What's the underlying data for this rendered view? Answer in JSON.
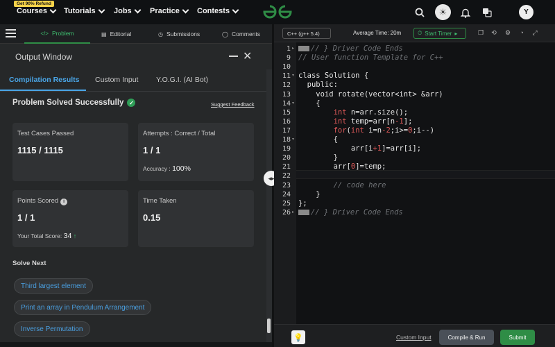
{
  "topnav": {
    "refund_badge": "Get 90% Refund",
    "items": [
      "Courses",
      "Tutorials",
      "Jobs",
      "Practice",
      "Contests"
    ],
    "logo": "gfg-logo",
    "avatar_letter": "Y"
  },
  "problem_tabs": {
    "items": [
      "Problem",
      "Editorial",
      "Submissions",
      "Comments"
    ],
    "active": "Problem"
  },
  "output": {
    "title": "Output Window",
    "tabs": [
      "Compilation Results",
      "Custom Input",
      "Y.O.G.I. (AI Bot)"
    ],
    "active_tab": "Compilation Results",
    "status": "Problem Solved Successfully",
    "feedback_link": "Suggest Feedback",
    "cards": {
      "test_cases_label": "Test Cases Passed",
      "test_cases_value": "1115 / 1115",
      "attempts_label": "Attempts : Correct / Total",
      "attempts_value": "1 / 1",
      "accuracy_label": "Accuracy :",
      "accuracy_value": "100%",
      "points_label": "Points Scored",
      "points_value": "1 / 1",
      "total_score_label": "Your Total Score:",
      "total_score_value": "34",
      "time_label": "Time Taken",
      "time_value": "0.15"
    },
    "solve_next_label": "Solve Next",
    "solve_next": [
      "Third largest element",
      "Print an array in Pendulum Arrangement",
      "Inverse Permutation"
    ]
  },
  "editor": {
    "language": "C++ (g++ 5.4)",
    "avg_time": "Average Time: 20m",
    "timer_label": "Start Timer",
    "lines": [
      {
        "n": "1",
        "fold": "▸",
        "parts": [
          [
            "marker",
            ""
          ],
          [
            "cmt",
            "// } Driver Code Ends"
          ]
        ]
      },
      {
        "n": "9",
        "fold": "",
        "parts": [
          [
            "cmt",
            "// User function Template for C++"
          ]
        ]
      },
      {
        "n": "10",
        "fold": "",
        "parts": []
      },
      {
        "n": "11",
        "fold": "▾",
        "parts": [
          [
            "txt",
            "class Solution {"
          ]
        ]
      },
      {
        "n": "12",
        "fold": "",
        "parts": [
          [
            "txt",
            "  public:"
          ]
        ]
      },
      {
        "n": "13",
        "fold": "",
        "parts": [
          [
            "txt",
            "    void rotate(vector<int> &arr)"
          ]
        ]
      },
      {
        "n": "14",
        "fold": "▾",
        "parts": [
          [
            "txt",
            "    {"
          ]
        ]
      },
      {
        "n": "15",
        "fold": "",
        "parts": [
          [
            "txt",
            "        "
          ],
          [
            "kw",
            "int"
          ],
          [
            "txt",
            " n=arr.size();"
          ]
        ]
      },
      {
        "n": "16",
        "fold": "",
        "parts": [
          [
            "txt",
            "        "
          ],
          [
            "kw",
            "int"
          ],
          [
            "txt",
            " temp=arr[n"
          ],
          [
            "num",
            "-1"
          ],
          [
            "txt",
            "];"
          ]
        ]
      },
      {
        "n": "17",
        "fold": "",
        "parts": [
          [
            "txt",
            "        "
          ],
          [
            "kw",
            "for"
          ],
          [
            "txt",
            "("
          ],
          [
            "kw",
            "int"
          ],
          [
            "txt",
            " i=n"
          ],
          [
            "num",
            "-2"
          ],
          [
            "txt",
            ";i>="
          ],
          [
            "num",
            "0"
          ],
          [
            "txt",
            ";i--)"
          ]
        ]
      },
      {
        "n": "18",
        "fold": "▾",
        "parts": [
          [
            "txt",
            "        {"
          ]
        ]
      },
      {
        "n": "19",
        "fold": "",
        "parts": [
          [
            "txt",
            "            arr[i"
          ],
          [
            "num",
            "+1"
          ],
          [
            "txt",
            "]=arr[i];"
          ]
        ]
      },
      {
        "n": "20",
        "fold": "",
        "parts": [
          [
            "txt",
            "        }"
          ]
        ]
      },
      {
        "n": "21",
        "fold": "",
        "parts": [
          [
            "txt",
            "        arr["
          ],
          [
            "num",
            "0"
          ],
          [
            "txt",
            "]=temp;"
          ]
        ]
      },
      {
        "n": "22",
        "fold": "",
        "parts": [
          [
            "txt",
            "        "
          ]
        ]
      },
      {
        "n": "23",
        "fold": "",
        "parts": [
          [
            "cmt",
            "        // code here"
          ]
        ]
      },
      {
        "n": "24",
        "fold": "",
        "parts": [
          [
            "txt",
            "    }"
          ]
        ]
      },
      {
        "n": "25",
        "fold": "",
        "parts": [
          [
            "txt",
            "};"
          ]
        ]
      },
      {
        "n": "26",
        "fold": "▸",
        "parts": [
          [
            "marker",
            ""
          ],
          [
            "cmt",
            "// } Driver Code Ends"
          ]
        ]
      }
    ]
  },
  "footer": {
    "custom_input": "Custom Input",
    "compile_run": "Compile & Run",
    "submit": "Submit"
  }
}
